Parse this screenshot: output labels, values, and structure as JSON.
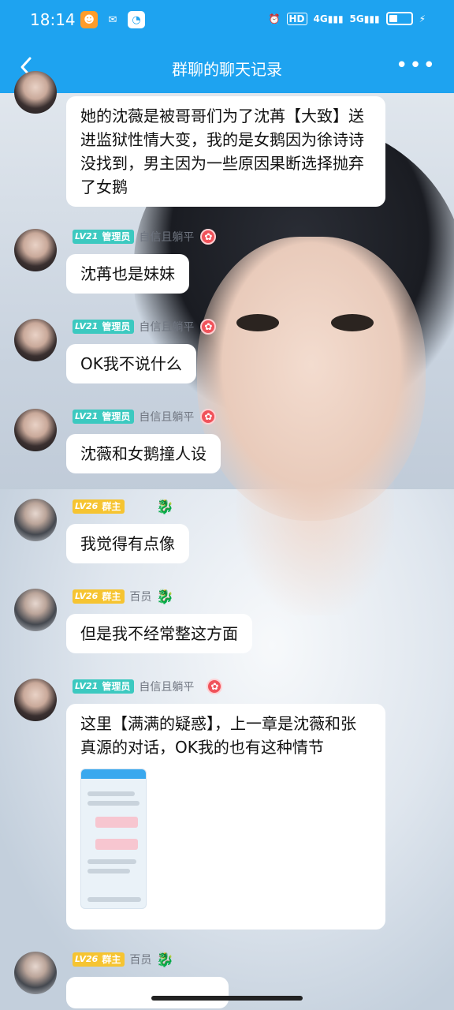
{
  "status_bar": {
    "time": "18:14",
    "hd": "HD",
    "net1": "4G",
    "net2": "5G",
    "battery_percent": 40,
    "accent_color": "#1ea3f0"
  },
  "header": {
    "title": "群聊的聊天记录",
    "back_icon": "chevron-left-icon",
    "more_icon": "more-dots-icon"
  },
  "messages": [
    {
      "text": "她的沈薇是被哥哥们为了沈苒【大致】送进监狱性情大变，我的是女鹅因为徐诗诗没找到，男主因为一些原因果断选择抛弃了女鹅"
    },
    {
      "level": "LV21",
      "role": "管理员",
      "nick": "自信且躺平",
      "text": "沈苒也是妹妹"
    },
    {
      "level": "LV21",
      "role": "管理员",
      "nick": "自信且躺平",
      "text": "OK我不说什么"
    },
    {
      "level": "LV21",
      "role": "管理员",
      "nick": "自信且躺平",
      "text": "沈薇和女鹅撞人设"
    },
    {
      "level": "LV26",
      "role": "群主",
      "nick": "",
      "text": "我觉得有点像"
    },
    {
      "level": "LV26",
      "role": "群主",
      "nick": "百员",
      "text": "但是我不经常整这方面"
    },
    {
      "level": "LV21",
      "role": "管理员",
      "nick": "自信且躺平",
      "text": "这里【满满的疑惑】，上一章是沈薇和张真源的对话，OK我的也有这种情节"
    },
    {
      "level": "LV26",
      "role": "群主",
      "nick": "百员",
      "text": ""
    }
  ]
}
